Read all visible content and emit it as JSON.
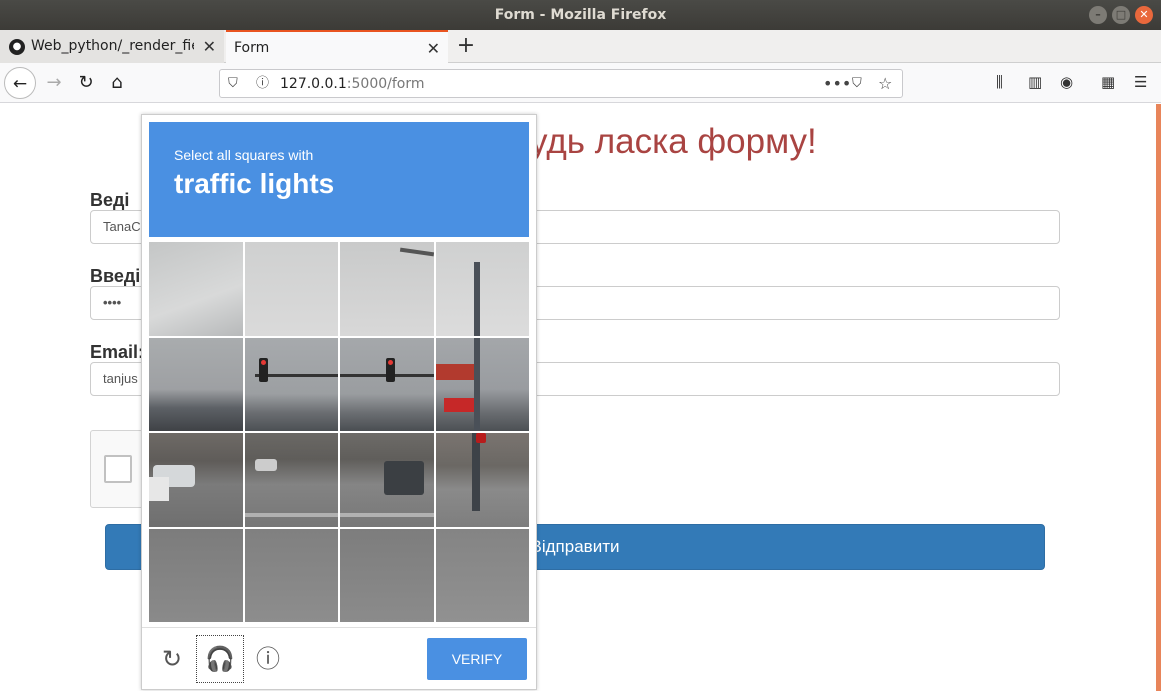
{
  "window": {
    "title": "Form - Mozilla Firefox"
  },
  "tabs": [
    {
      "label": "Web_python/_render_field"
    },
    {
      "label": "Form"
    }
  ],
  "url": {
    "host": "127.0.0.1",
    "rest": ":5000/form"
  },
  "page": {
    "heading": "удь ласка форму!",
    "fields": [
      {
        "label": "Веді",
        "value": "TanaC"
      },
      {
        "label": "Введі",
        "value": "••••"
      },
      {
        "label": "Email:",
        "value": "tanjus"
      }
    ],
    "submit": "Відправити"
  },
  "captcha": {
    "instruction": "Select all squares with",
    "target": "traffic lights",
    "verify": "VERIFY"
  },
  "colors": {
    "captcha_blue": "#4a90e2",
    "submit_blue": "#337ab7",
    "heading": "#a94442"
  }
}
